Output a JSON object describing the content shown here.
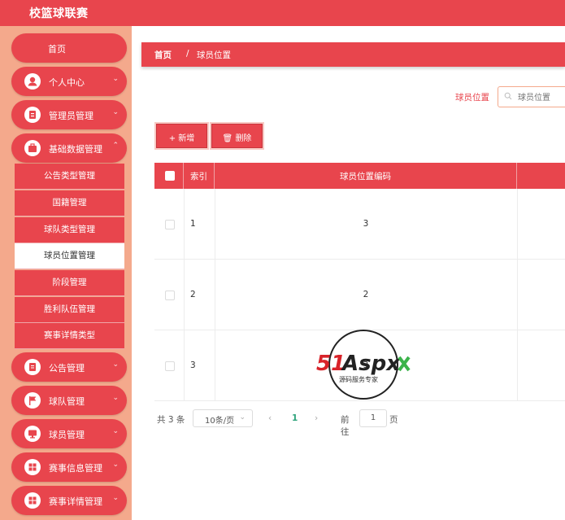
{
  "app": {
    "title": "校篮球联赛"
  },
  "sidebar": {
    "home": "首页",
    "menus_top": [
      {
        "label": "个人中心",
        "icon": "user-icon"
      },
      {
        "label": "管理员管理",
        "icon": "admin-icon"
      },
      {
        "label": "基础数据管理",
        "icon": "briefcase-icon"
      }
    ],
    "submenu": [
      "公告类型管理",
      "国籍管理",
      "球队类型管理",
      "球员位置管理",
      "阶段管理",
      "胜利队伍管理",
      "赛事详情类型"
    ],
    "active_submenu": "球员位置管理",
    "menus_bottom": [
      {
        "label": "公告管理",
        "icon": "document-icon"
      },
      {
        "label": "球队管理",
        "icon": "flag-icon"
      },
      {
        "label": "球员管理",
        "icon": "monitor-icon"
      },
      {
        "label": "赛事信息管理",
        "icon": "grid-icon"
      },
      {
        "label": "赛事详情管理",
        "icon": "grid-icon"
      }
    ]
  },
  "breadcrumb": {
    "home": "首页",
    "separator": "/",
    "current": "球员位置"
  },
  "filter": {
    "label": "球员位置",
    "placeholder": "球员位置"
  },
  "toolbar": {
    "add_label": "+ 新增",
    "delete_label": "删除"
  },
  "table": {
    "headers": [
      "索引",
      "球员位置编码"
    ],
    "rows": [
      {
        "index": "1",
        "code": "3"
      },
      {
        "index": "2",
        "code": "2"
      },
      {
        "index": "3",
        "code": "3"
      }
    ]
  },
  "pagination": {
    "total": "共 3 条",
    "page_size": "10条/页",
    "prev": "‹",
    "current_page": "1",
    "next": "›",
    "goto_label": "前往",
    "goto_value": "1",
    "goto_suffix": "页"
  },
  "watermark": {
    "brand": "51Aspx",
    "subtitle": "源码服务专家"
  },
  "colors": {
    "accent": "#e8454d",
    "sidebar_bg": "#f4a98c",
    "page_active": "#2ea37b"
  }
}
